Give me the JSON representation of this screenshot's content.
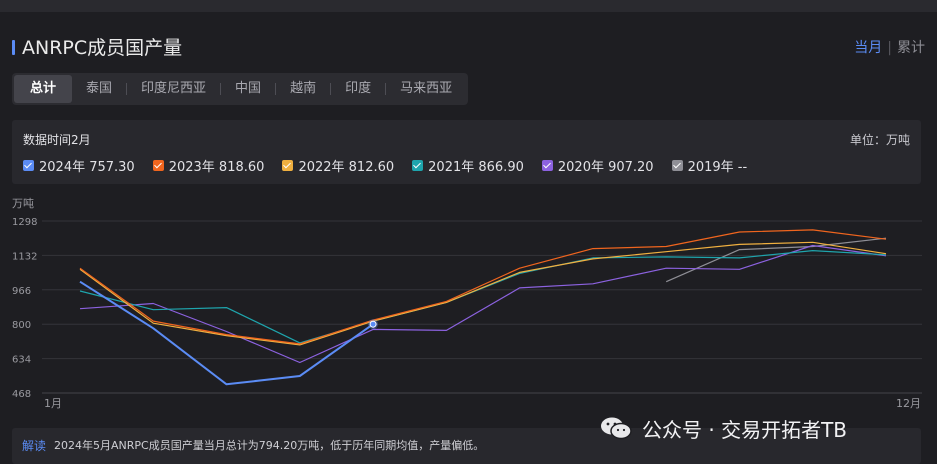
{
  "header": {
    "title": "ANRPC成员国产量",
    "period_active": "当月",
    "period_sep": "|",
    "period_inactive": "累计"
  },
  "tabs": [
    "总计",
    "泰国",
    "印度尼西亚",
    "中国",
    "越南",
    "印度",
    "马来西亚"
  ],
  "panel": {
    "date_label": "数据时间2月",
    "unit_label": "单位：万吨"
  },
  "legend": [
    {
      "label": "2024年 757.30",
      "color": "#5b8cf5"
    },
    {
      "label": "2023年 818.60",
      "color": "#f0651e"
    },
    {
      "label": "2022年 812.60",
      "color": "#f0b040"
    },
    {
      "label": "2021年 866.90",
      "color": "#1ea5ad"
    },
    {
      "label": "2020年 907.20",
      "color": "#8c62e0"
    },
    {
      "label": "2019年 --",
      "color": "#8f8f96"
    }
  ],
  "chart_data": {
    "type": "line",
    "ylabel": "万吨",
    "x": [
      1,
      2,
      3,
      4,
      5,
      6,
      7,
      8,
      9,
      10,
      11,
      12
    ],
    "x_tick_labels": {
      "first": "1月",
      "last": "12月"
    },
    "y_ticks": [
      468,
      634,
      800,
      966,
      1132,
      1298
    ],
    "ylim": [
      468,
      1298
    ],
    "grid": true,
    "series": [
      {
        "name": "2024年",
        "color": "#5b8cf5",
        "values": [
          1005,
          780,
          510,
          550,
          800,
          null,
          null,
          null,
          null,
          null,
          null,
          null
        ]
      },
      {
        "name": "2023年",
        "color": "#f0651e",
        "values": [
          1070,
          815,
          750,
          705,
          820,
          910,
          1070,
          1165,
          1175,
          1245,
          1255,
          1210
        ]
      },
      {
        "name": "2022年",
        "color": "#f0b040",
        "values": [
          1065,
          805,
          745,
          700,
          815,
          905,
          1050,
          1115,
          1150,
          1185,
          1195,
          1140
        ]
      },
      {
        "name": "2021年",
        "color": "#1ea5ad",
        "values": [
          960,
          870,
          880,
          710,
          815,
          905,
          1045,
          1120,
          1125,
          1120,
          1155,
          1135
        ]
      },
      {
        "name": "2020年",
        "color": "#8c62e0",
        "values": [
          875,
          900,
          765,
          615,
          775,
          770,
          975,
          995,
          1070,
          1065,
          1180,
          1130
        ]
      },
      {
        "name": "2019年",
        "color": "#8f8f96",
        "values": [
          null,
          null,
          null,
          null,
          null,
          null,
          null,
          null,
          1005,
          1160,
          1175,
          1215
        ]
      }
    ]
  },
  "bottom": {
    "label": "解读",
    "text": "2024年5月ANRPC成员国产量当月总计为794.20万吨，低于历年同期均值，产量偏低。"
  },
  "watermark": {
    "text": "公众号 · 交易开拓者TB"
  }
}
